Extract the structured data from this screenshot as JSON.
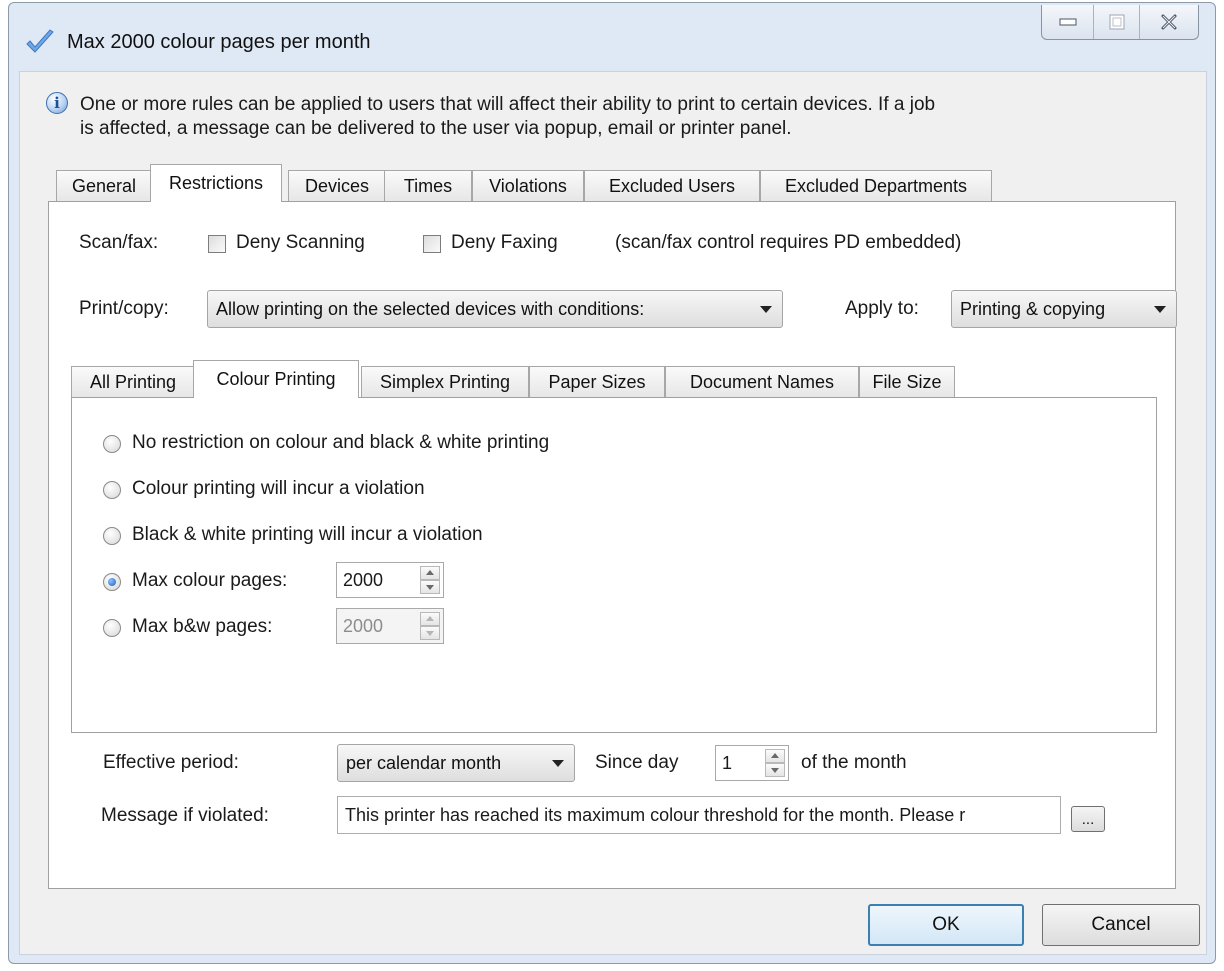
{
  "window": {
    "title": "Max 2000 colour pages per month",
    "icons": {
      "app": "checkmark-icon",
      "minimize": "minimize-icon",
      "maximize": "maximize-icon",
      "close": "close-icon",
      "info": "info-icon"
    }
  },
  "info": {
    "line1": "One or more rules can be applied to users that will affect their ability to print to certain devices. If a job",
    "line2": "is affected, a message can be delivered to the user via popup, email or printer panel."
  },
  "main_tabs": [
    {
      "label": "General",
      "active": false
    },
    {
      "label": "Restrictions",
      "active": true
    },
    {
      "label": "Devices",
      "active": false
    },
    {
      "label": "Times",
      "active": false
    },
    {
      "label": "Violations",
      "active": false
    },
    {
      "label": "Excluded Users",
      "active": false
    },
    {
      "label": "Excluded Departments",
      "active": false
    }
  ],
  "restrictions": {
    "scanfax_label": "Scan/fax:",
    "deny_scanning_label": "Deny Scanning",
    "deny_scanning_checked": false,
    "deny_faxing_label": "Deny Faxing",
    "deny_faxing_checked": false,
    "scanfax_note": "(scan/fax control requires PD embedded)",
    "printcopy_label": "Print/copy:",
    "printcopy_value": "Allow printing on the selected devices with conditions:",
    "applyto_label": "Apply to:",
    "applyto_value": "Printing & copying"
  },
  "sub_tabs": [
    {
      "label": "All Printing",
      "active": false
    },
    {
      "label": "Colour Printing",
      "active": true
    },
    {
      "label": "Simplex Printing",
      "active": false
    },
    {
      "label": "Paper Sizes",
      "active": false
    },
    {
      "label": "Document Names",
      "active": false
    },
    {
      "label": "File Size",
      "active": false
    }
  ],
  "colour_printing": {
    "options": [
      {
        "label": "No restriction on colour and black & white printing",
        "selected": false
      },
      {
        "label": "Colour printing will incur a violation",
        "selected": false
      },
      {
        "label": "Black & white printing will incur a violation",
        "selected": false
      },
      {
        "label": "Max colour pages:",
        "selected": true
      },
      {
        "label": "Max b&w pages:",
        "selected": false
      }
    ],
    "max_colour_value": "2000",
    "max_bw_value": "2000"
  },
  "effective": {
    "period_label": "Effective period:",
    "period_value": "per calendar month",
    "since_label": "Since day",
    "since_value": "1",
    "suffix": "of the month"
  },
  "message": {
    "label": "Message if violated:",
    "value": "This printer has reached its maximum colour threshold for the month. Please r",
    "browse_label": "..."
  },
  "buttons": {
    "ok": "OK",
    "cancel": "Cancel"
  }
}
